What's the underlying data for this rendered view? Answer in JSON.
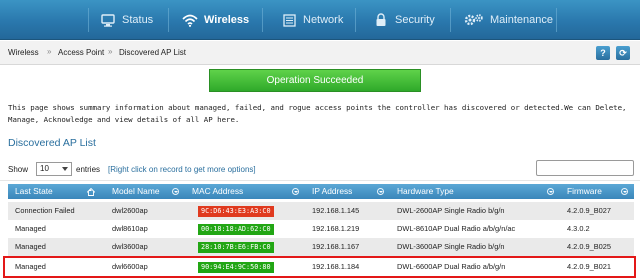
{
  "nav": {
    "items": [
      {
        "label": "Status",
        "icon": "monitor-icon"
      },
      {
        "label": "Wireless",
        "icon": "wifi-icon",
        "active": true
      },
      {
        "label": "Network",
        "icon": "network-icon"
      },
      {
        "label": "Security",
        "icon": "lock-icon"
      },
      {
        "label": "Maintenance",
        "icon": "gears-icon"
      }
    ]
  },
  "breadcrumb": {
    "items": [
      "Wireless",
      "Access Point",
      "Discovered AP List"
    ],
    "separator": "»"
  },
  "help_button": "?",
  "refresh_button": "⟳",
  "banner": {
    "text": "Operation Succeeded",
    "color": "#3cb832"
  },
  "description": "This page shows summary information about managed, failed, and rogue access points the controller has discovered or detected.We can Delete, Manage, Acknowledge and view details of all AP here.",
  "section_title": "Discovered AP List",
  "controls": {
    "show_label": "Show",
    "show_value": "10",
    "entries_label": "entries",
    "hint": "[Right click on record to get more options]",
    "search_placeholder": ""
  },
  "table": {
    "headers": [
      "Last State",
      "Model Name",
      "MAC Address",
      "IP Address",
      "Hardware Type",
      "Firmware"
    ],
    "rows": [
      {
        "state": "Connection Failed",
        "model": "dwl2600ap",
        "mac": "9C:D6:43:E3:A3:C0",
        "mac_status": "red",
        "ip": "192.168.1.145",
        "hw": "DWL-2600AP Single Radio b/g/n",
        "fw": "4.2.0.9_B027"
      },
      {
        "state": "Managed",
        "model": "dwl8610ap",
        "mac": "00:18:18:AD:62:C0",
        "mac_status": "green",
        "ip": "192.168.1.219",
        "hw": "DWL-8610AP Dual Radio a/b/g/n/ac",
        "fw": "4.3.0.2"
      },
      {
        "state": "Managed",
        "model": "dwl3600ap",
        "mac": "28:10:7B:E6:FB:C0",
        "mac_status": "green",
        "ip": "192.168.1.167",
        "hw": "DWL-3600AP Single Radio b/g/n",
        "fw": "4.2.0.9_B025"
      },
      {
        "state": "Managed",
        "model": "dwl6600ap",
        "mac": "90:94:E4:9C:50:80",
        "mac_status": "green",
        "ip": "192.168.1.184",
        "hw": "DWL-6600AP Dual Radio a/b/g/n",
        "fw": "4.2.0.9_B021"
      }
    ]
  },
  "colors": {
    "accent": "#2a78ad",
    "mac_red": "#e03a1f",
    "mac_green": "#22a614",
    "highlight": "#e31818"
  }
}
